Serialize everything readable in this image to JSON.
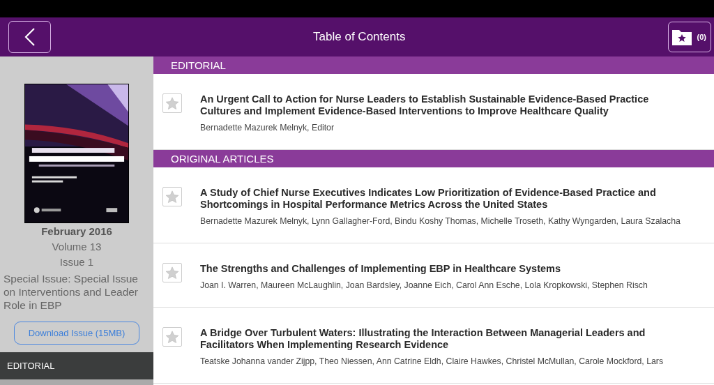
{
  "header": {
    "title": "Table of Contents",
    "saved_count": "(0)"
  },
  "issue": {
    "date": "February 2016",
    "volume": "Volume 13",
    "issue": "Issue 1",
    "description": "Special Issue: Special Issue on Interventions and Leader Role in EBP",
    "download": "Download Issue (15MB)"
  },
  "sidebar_sections": [
    {
      "label": "EDITORIAL",
      "selected": true
    }
  ],
  "sections": [
    {
      "title": "EDITORIAL",
      "articles": [
        {
          "title": "An Urgent Call to Action for Nurse Leaders to Establish Sustainable Evidence-Based Practice Cultures and Implement Evidence-Based Interventions to Improve Healthcare Quality",
          "authors": "Bernadette Mazurek Melnyk, Editor",
          "starred": false
        }
      ]
    },
    {
      "title": "ORIGINAL ARTICLES",
      "articles": [
        {
          "title": "A Study of Chief Nurse Executives Indicates Low Prioritization of Evidence-Based Practice and Shortcomings in Hospital Performance Metrics Across the United States",
          "authors": "Bernadette Mazurek Melnyk, Lynn Gallagher-Ford, Bindu Koshy Thomas, Michelle Troseth, Kathy Wyngarden, Laura Szalacha",
          "starred": false
        },
        {
          "title": "The Strengths and Challenges of Implementing EBP in Healthcare Systems",
          "authors": "Joan I. Warren, Maureen McLaughlin, Joan Bardsley, Joanne Eich, Carol Ann Esche, Lola Kropkowski, Stephen Risch",
          "starred": false
        },
        {
          "title": "A Bridge Over Turbulent Waters: Illustrating the Interaction Between Managerial Leaders and Facilitators When Implementing Research Evidence",
          "authors": "Teatske Johanna vander Zijpp, Theo Niessen, Ann Catrine Eldh, Claire Hawkes, Christel McMullan, Carole Mockford, Lars",
          "starred": false
        }
      ]
    }
  ]
}
